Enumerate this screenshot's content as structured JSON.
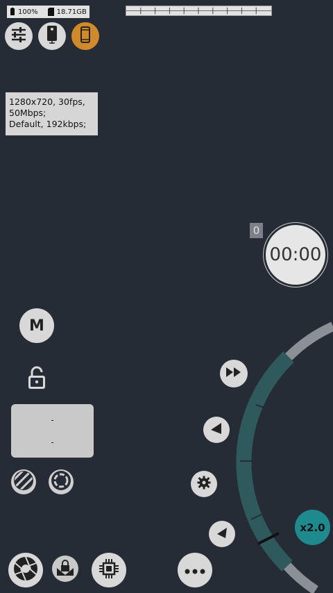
{
  "status": {
    "battery_icon": "battery-icon",
    "battery": "100%",
    "storage_icon": "sd-card-icon",
    "storage": "18.71GB"
  },
  "top_buttons": [
    {
      "name": "settings-sliders-button",
      "icon": "sliders-icon"
    },
    {
      "name": "camera-switch-button",
      "icon": "phone-camera-icon"
    },
    {
      "name": "orientation-button",
      "icon": "phone-icon",
      "active_color": "#d08a2a"
    }
  ],
  "info": {
    "video_line1": "1280x720, 30fps,",
    "video_line2": "50Mbps;",
    "audio_line": "Default, 192kbps;"
  },
  "record": {
    "counter": "0",
    "timer": "00:00"
  },
  "left_controls": {
    "mode": "M",
    "lock_icon": "unlock-icon",
    "exposure_value1": "-",
    "exposure_value2": "-",
    "stripes_icon": "zebra-stripes-icon",
    "focus_peaking_icon": "focus-peaking-icon"
  },
  "right_controls": {
    "fast_forward_icon": "fast-forward-icon",
    "prev_icon": "triangle-left-icon",
    "gear_icon": "gear-icon",
    "next_icon": "triangle-right-icon",
    "zoom": "x2.0"
  },
  "bottom_bar": {
    "shutter_icon": "shutter-aperture-icon",
    "ae_lock_icon": "exposure-lock-icon",
    "processor_icon": "chip-icon",
    "more_icon": "more-icon"
  },
  "colors": {
    "background": "#262c35",
    "accent_orange": "#d08a2a",
    "accent_teal": "#1e8a8d",
    "dial_teal": "#2e5a5e"
  }
}
